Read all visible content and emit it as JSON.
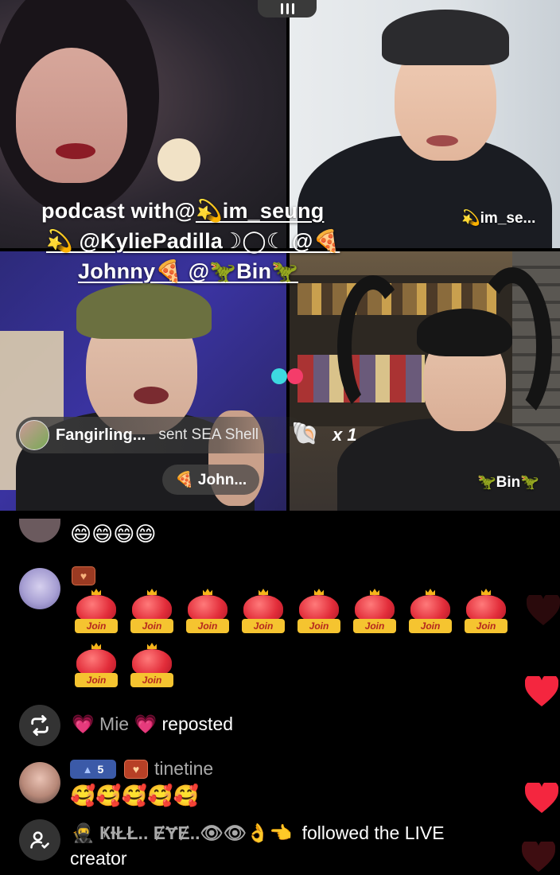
{
  "stream": {
    "title_line1_prefix": "podcast with@",
    "title_line1_user": "💫im_seung",
    "title_line2": "💫 @KyliePadilla☽◯☾ @🍕",
    "title_line3": "Johnny🍕 @🦖Bin🦖"
  },
  "participants": {
    "top_right_tag": "💫im_se...",
    "bottom_left_tag": "🍕 John...",
    "bottom_right_tag": "🦖Bin🦖"
  },
  "gift": {
    "sender": "Fangirling...",
    "action": "sent SEA Shell",
    "icon": "🐚",
    "count": "x 1"
  },
  "chat": {
    "top_emojis": "😄😄😄😄",
    "level_badge_1": "♥",
    "join_label": "Join",
    "join_count": 10,
    "repost": {
      "heart_left": "💗",
      "name": "Mie",
      "heart_right": "💗",
      "action": "reposted"
    },
    "tinetine": {
      "level": "5",
      "level_icon": "▲",
      "heart_badge": "♥",
      "name": "tinetine",
      "emojis": "🥰🥰🥰🥰🥰"
    },
    "follow": {
      "name": "🥷 ҜƗŁŁ.. ɆɎɆ..👁👁👌👈",
      "action_line1": "followed the LIVE",
      "action_line2": "creator"
    }
  },
  "colors": {
    "heart_red": "#f4263f",
    "heart_dark": "#4a1416",
    "join_gold": "#f5c430",
    "bg": "#000000"
  }
}
